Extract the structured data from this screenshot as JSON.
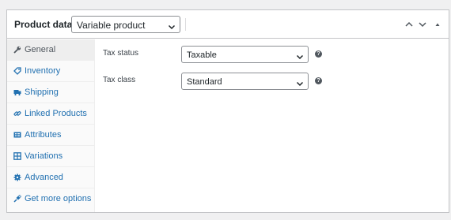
{
  "header": {
    "title": "Product data —",
    "product_type": "Variable product",
    "buttons": [
      "chevron-up-icon",
      "chevron-down-icon",
      "triangle-up-icon"
    ]
  },
  "tabs": [
    {
      "label": "General",
      "icon": "wrench-icon",
      "active": true
    },
    {
      "label": "Inventory",
      "icon": "tag-icon"
    },
    {
      "label": "Shipping",
      "icon": "truck-icon"
    },
    {
      "label": "Linked Products",
      "icon": "link-icon"
    },
    {
      "label": "Attributes",
      "icon": "list-icon"
    },
    {
      "label": "Variations",
      "icon": "grid-icon"
    },
    {
      "label": "Advanced",
      "icon": "gear-icon"
    },
    {
      "label": "Get more options",
      "icon": "plugin-icon"
    }
  ],
  "fields": {
    "tax_status": {
      "label": "Tax status",
      "value": "Taxable"
    },
    "tax_class": {
      "label": "Tax class",
      "value": "Standard"
    }
  },
  "help_glyph": "?",
  "colors": {
    "link": "#2271b1",
    "active_tab_bg": "#eeeeee",
    "border": "#c3c4c7"
  }
}
